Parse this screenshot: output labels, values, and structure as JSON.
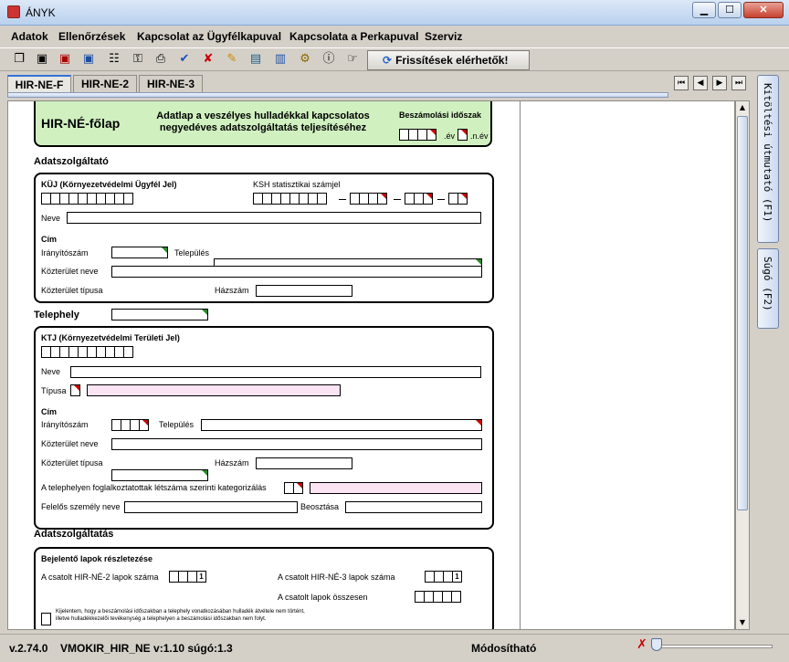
{
  "window": {
    "title": "ÁNYK"
  },
  "menu": [
    "Adatok",
    "Ellenőrzések",
    "Kapcsolat az Ügyfélkapuval",
    "Kapcsolata a Perkapuval",
    "Szerviz"
  ],
  "toolbar": {
    "icons": [
      "copy-icon",
      "save-icon",
      "save-close-icon",
      "save-as-icon",
      "import-icon",
      "lock-icon",
      "print-icon",
      "check-icon",
      "cross-icon",
      "edit-icon",
      "calculator-icon",
      "book-icon",
      "tools-icon",
      "info-icon",
      "pointer-icon"
    ],
    "refresh_label": "Frissítések elérhetők!"
  },
  "tabs": [
    "HIR-NE-F",
    "HIR-NE-2",
    "HIR-NE-3"
  ],
  "side_tabs": [
    "Kitöltési útmutató (F1)",
    "Súgó (F2)"
  ],
  "form": {
    "title": "HIR-NÉ-főlap",
    "description": "Adatlap a veszélyes hulladékkal kapcsolatos negyedéves adatszolgáltatás teljesítéséhez",
    "period_label": "Beszámolási időszak",
    "year_suffix": ".év",
    "quarter_suffix": ".n.év",
    "sec1": {
      "title": "Adatszolgáltató",
      "kuj_label": "KÜJ (Környezetvédelmi Ügyfél Jel)",
      "ksh_label": "KSH statisztikai számjel",
      "name_label": "Neve",
      "address_label": "Cím",
      "zip_label": "Irányítószám",
      "city_label": "Település",
      "street_label": "Közterület neve",
      "street_type_label": "Közterület típusa",
      "house_label": "Házszám"
    },
    "sec2": {
      "title": "Telephely",
      "ktj_label": "KTJ (Környezetvédelmi Területi Jel)",
      "name_label": "Neve",
      "type_label": "Típusa",
      "address_label": "Cím",
      "zip_label": "Irányítószám",
      "city_label": "Település",
      "street_label": "Közterület neve",
      "street_type_label": "Közterület típusa",
      "house_label": "Házszám",
      "category_label": "A telephelyen foglalkoztatottak létszáma szerinti kategorizálás",
      "responsible_label": "Felelős személy neve",
      "position_label": "Beosztása"
    },
    "sec3": {
      "title": "Adatszolgáltatás",
      "detail_label": "Bejelentő lapok részletezése",
      "hir2_label": "A csatolt HIR-NÉ-2 lapok száma",
      "hir2_value": "1",
      "hir3_label": "A csatolt HIR-NÉ-3 lapok száma",
      "hir3_value": "1",
      "total_label": "A csatolt lapok összesen",
      "declaration_line1": "Kijelentem, hogy a beszámolási időszakban a telephely vonatkozásában hulladék átvétele nem történt,",
      "declaration_line2": "illetve hulladékkezelői tevékenység a telephelyen a beszámolási időszakban nem folyt."
    }
  },
  "status": {
    "version": "v.2.74.0",
    "form_info": "VMOKIR_HIR_NE v:1.10 súgó:1.3",
    "mode": "Módosítható"
  }
}
